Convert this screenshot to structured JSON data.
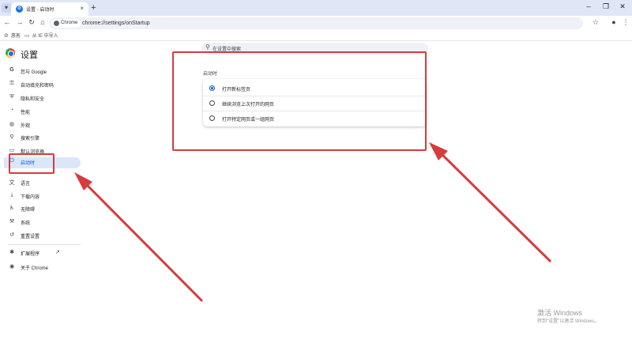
{
  "browser": {
    "tab_title": "设置 - 启动时",
    "tab_close": "×",
    "new_tab": "+",
    "chip_label": "Chrome",
    "url": "chrome://settings/onStartup",
    "bookmarks": [
      "惠客",
      "从 IE 中导入"
    ]
  },
  "header": {
    "title": "设置",
    "search_placeholder": "在设置中搜索"
  },
  "sidebar": {
    "items": [
      {
        "label": "您与 Google",
        "icon": "google-icon"
      },
      {
        "label": "自动填充和密码",
        "icon": "key-icon"
      },
      {
        "label": "隐私和安全",
        "icon": "shield-icon"
      },
      {
        "label": "性能",
        "icon": "speedometer-icon"
      },
      {
        "label": "外观",
        "icon": "palette-icon"
      },
      {
        "label": "搜索引擎",
        "icon": "search-icon"
      },
      {
        "label": "默认浏览器",
        "icon": "browser-icon"
      },
      {
        "label": "启动时",
        "icon": "power-icon"
      },
      {
        "label": "语言",
        "icon": "translate-icon"
      },
      {
        "label": "下载内容",
        "icon": "download-icon"
      },
      {
        "label": "无障碍",
        "icon": "accessibility-icon"
      },
      {
        "label": "系统",
        "icon": "wrench-icon"
      },
      {
        "label": "重置设置",
        "icon": "reset-icon"
      },
      {
        "label": "扩展程序",
        "icon": "puzzle-icon"
      },
      {
        "label": "关于 Chrome",
        "icon": "chrome-icon"
      }
    ],
    "active_index": 7
  },
  "main": {
    "section_title": "启动时",
    "options": [
      {
        "label": "打开新标签页",
        "checked": true
      },
      {
        "label": "继续浏览上次打开的网页",
        "checked": false
      },
      {
        "label": "打开特定网页或一组网页",
        "checked": false
      }
    ]
  },
  "watermark": {
    "line1": "激活 Windows",
    "line2": "转到\"设置\"以激活 Windows。"
  },
  "colors": {
    "accent": "#0b57d0",
    "annotation": "#d63c3c",
    "active_bg": "#dce6f9"
  }
}
